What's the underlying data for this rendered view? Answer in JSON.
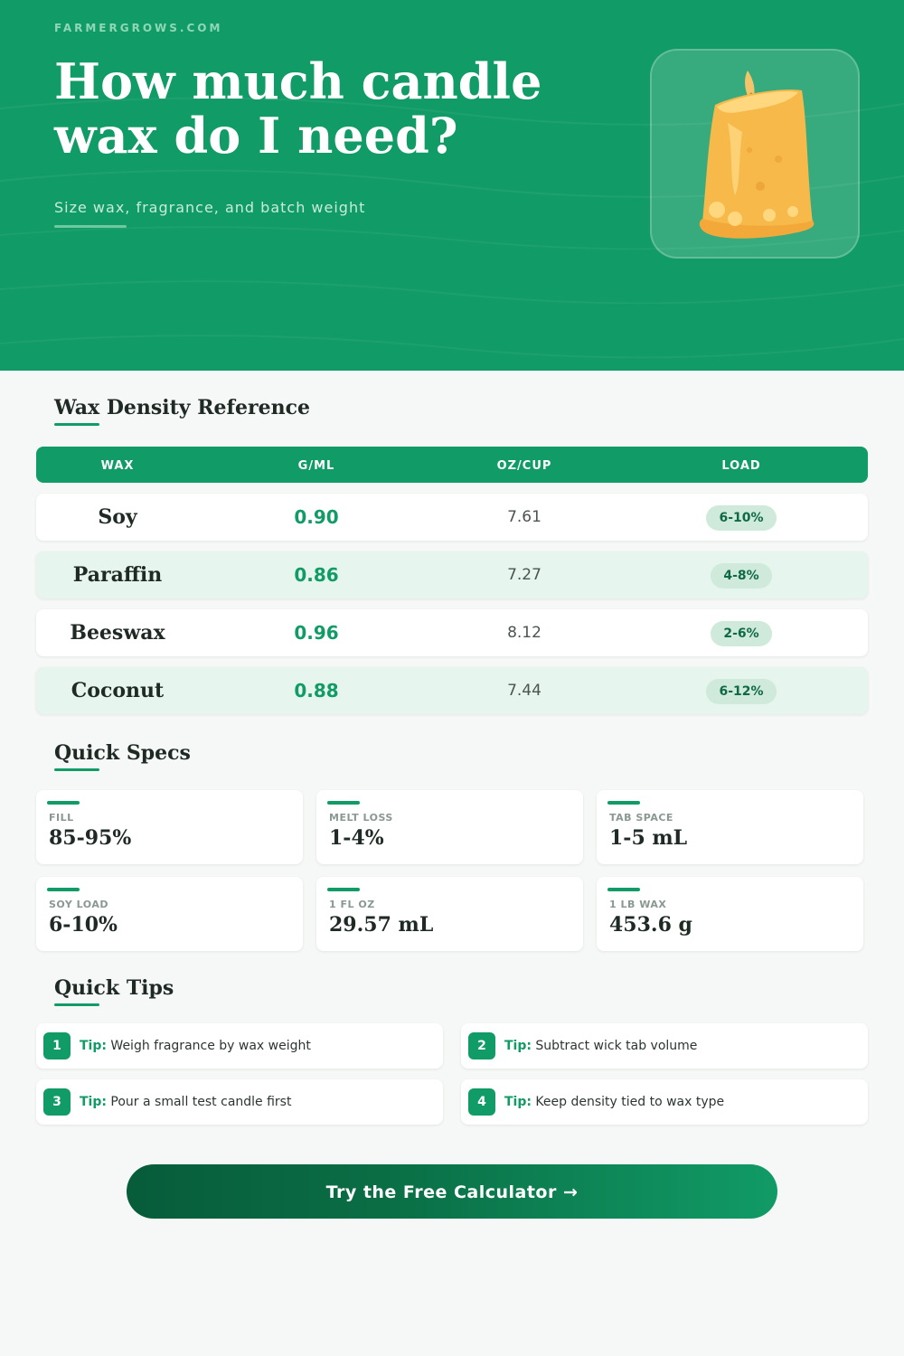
{
  "header": {
    "site": "FARMERGROWS.COM",
    "title": "How much candle wax do I need?",
    "subtitle": "Size wax, fragrance, and batch weight",
    "illustration_icon": "melting-candle-icon"
  },
  "colors": {
    "brand": "#119b66",
    "brand_dark": "#075c3a",
    "pill_bg": "#cfeadb",
    "row_alt": "#e6f5ed",
    "page_bg": "#f6f8f7"
  },
  "density": {
    "title": "Wax Density Reference",
    "columns": [
      "WAX",
      "G/ML",
      "OZ/CUP",
      "LOAD"
    ],
    "rows": [
      {
        "wax": "Soy",
        "gml": "0.90",
        "ozcup": "7.61",
        "load": "6-10%"
      },
      {
        "wax": "Paraffin",
        "gml": "0.86",
        "ozcup": "7.27",
        "load": "4-8%"
      },
      {
        "wax": "Beeswax",
        "gml": "0.96",
        "ozcup": "8.12",
        "load": "2-6%"
      },
      {
        "wax": "Coconut",
        "gml": "0.88",
        "ozcup": "7.44",
        "load": "6-12%"
      }
    ]
  },
  "specs": {
    "title": "Quick Specs",
    "items": [
      {
        "label": "FILL",
        "value": "85-95%"
      },
      {
        "label": "MELT LOSS",
        "value": "1-4%"
      },
      {
        "label": "TAB SPACE",
        "value": "1-5 mL"
      },
      {
        "label": "SOY LOAD",
        "value": "6-10%"
      },
      {
        "label": "1 FL OZ",
        "value": "29.57 mL"
      },
      {
        "label": "1 LB WAX",
        "value": "453.6 g"
      }
    ]
  },
  "tips": {
    "title": "Quick Tips",
    "prefix": "Tip:",
    "items": [
      {
        "num": "1",
        "text": "Weigh fragrance by wax weight"
      },
      {
        "num": "2",
        "text": "Subtract wick tab volume"
      },
      {
        "num": "3",
        "text": "Pour a small test candle first"
      },
      {
        "num": "4",
        "text": "Keep density tied to wax type"
      }
    ]
  },
  "cta": {
    "label": "Try the Free Calculator →"
  }
}
